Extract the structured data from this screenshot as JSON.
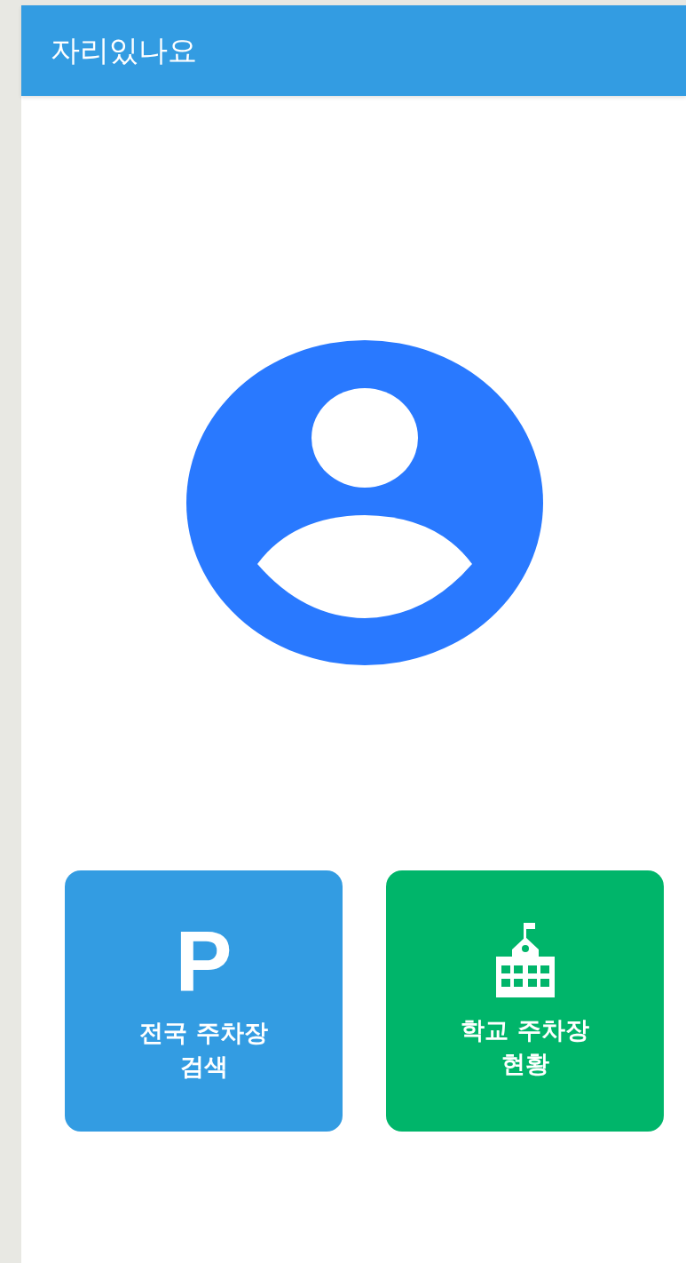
{
  "app_bar": {
    "title": "자리있나요"
  },
  "buttons": [
    {
      "kind": "parking",
      "icon_text": "P",
      "label": "전국 주차장\n검색",
      "color": "#339ce2"
    },
    {
      "kind": "school",
      "label": "학교 주차장\n현황",
      "color": "#00b56a"
    }
  ]
}
